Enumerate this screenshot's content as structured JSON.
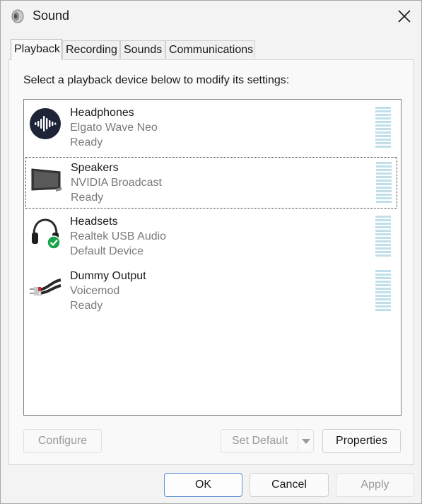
{
  "window": {
    "title": "Sound"
  },
  "tabs": [
    {
      "label": "Playback",
      "active": true
    },
    {
      "label": "Recording",
      "active": false
    },
    {
      "label": "Sounds",
      "active": false
    },
    {
      "label": "Communications",
      "active": false
    }
  ],
  "playback": {
    "instruction": "Select a playback device below to modify its settings:",
    "devices": [
      {
        "name": "Headphones",
        "description": "Elgato Wave Neo",
        "status": "Ready",
        "icon": "elgato-wave-icon",
        "selected": false
      },
      {
        "name": "Speakers",
        "description": "NVIDIA Broadcast",
        "status": "Ready",
        "icon": "monitor-speaker-icon",
        "selected": true
      },
      {
        "name": "Headsets",
        "description": "Realtek USB Audio",
        "status": "Default Device",
        "icon": "headset-default-icon",
        "selected": false
      },
      {
        "name": "Dummy Output",
        "description": "Voicemod",
        "status": "Ready",
        "icon": "rca-cable-icon",
        "selected": false
      }
    ],
    "buttons": {
      "configure": "Configure",
      "set_default": "Set Default",
      "properties": "Properties"
    }
  },
  "footer": {
    "ok": "OK",
    "cancel": "Cancel",
    "apply": "Apply"
  },
  "colors": {
    "accent": "#5a8fd6",
    "meter": "#bfe0ea",
    "default_check": "#16a34a"
  }
}
